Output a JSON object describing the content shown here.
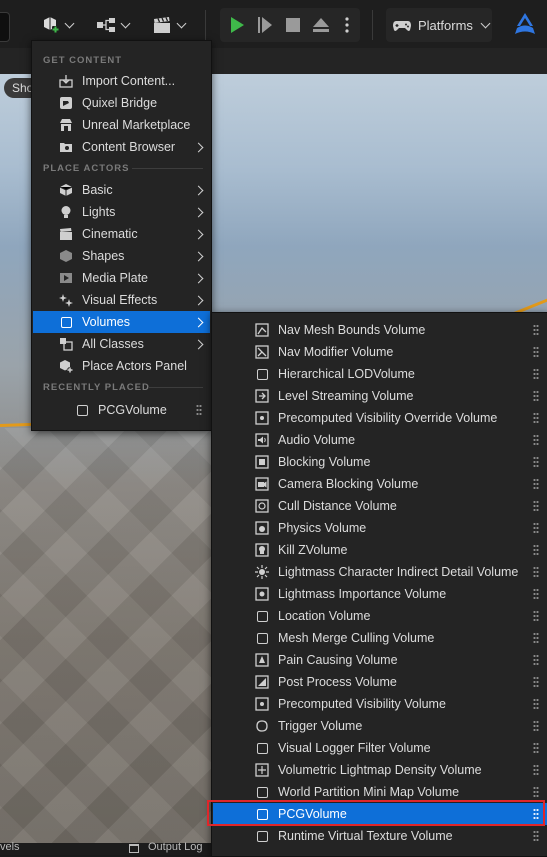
{
  "toolbar": {
    "platforms_label": "Platforms"
  },
  "viewport": {
    "show_label": "Sho"
  },
  "statusbar": {
    "left_text": "vels",
    "output_text": "Output Log"
  },
  "colors": {
    "accent": "#0e6fd8",
    "highlight": "#e0262a",
    "play_green": "#3fb94a"
  },
  "add_menu": {
    "get_content_header": "GET CONTENT",
    "get_content": [
      {
        "label": "Import Content...",
        "icon": "import-icon",
        "submenu": false
      },
      {
        "label": "Quixel Bridge",
        "icon": "bridge-icon",
        "submenu": false
      },
      {
        "label": "Unreal Marketplace",
        "icon": "marketplace-icon",
        "submenu": false
      },
      {
        "label": "Content Browser",
        "icon": "content-browser-icon",
        "submenu": true
      }
    ],
    "place_actors_header": "PLACE ACTORS",
    "place_actors": [
      {
        "label": "Basic",
        "icon": "cube-icon",
        "submenu": true
      },
      {
        "label": "Lights",
        "icon": "light-bulb-icon",
        "submenu": true
      },
      {
        "label": "Cinematic",
        "icon": "clapper-icon",
        "submenu": true
      },
      {
        "label": "Shapes",
        "icon": "shapes-icon",
        "submenu": true
      },
      {
        "label": "Media Plate",
        "icon": "media-plate-icon",
        "submenu": true
      },
      {
        "label": "Visual Effects",
        "icon": "sparkle-icon",
        "submenu": true
      },
      {
        "label": "Volumes",
        "icon": "volume-icon",
        "submenu": true,
        "active": true
      },
      {
        "label": "All Classes",
        "icon": "classes-icon",
        "submenu": true
      },
      {
        "label": "Place Actors Panel",
        "icon": "place-actors-icon",
        "submenu": false
      }
    ],
    "recently_placed_header": "RECENTLY PLACED",
    "recently_placed": [
      {
        "label": "PCGVolume",
        "icon": "volume-icon"
      }
    ]
  },
  "volumes_menu": {
    "items": [
      {
        "label": "Nav Mesh Bounds Volume",
        "icon": "nav-mesh-icon"
      },
      {
        "label": "Nav Modifier Volume",
        "icon": "nav-modifier-icon"
      },
      {
        "label": "Hierarchical LODVolume",
        "icon": "volume-icon"
      },
      {
        "label": "Level Streaming Volume",
        "icon": "streaming-icon"
      },
      {
        "label": "Precomputed Visibility Override Volume",
        "icon": "visibility-icon"
      },
      {
        "label": "Audio Volume",
        "icon": "audio-icon"
      },
      {
        "label": "Blocking Volume",
        "icon": "blocking-icon"
      },
      {
        "label": "Camera Blocking Volume",
        "icon": "camera-blocking-icon"
      },
      {
        "label": "Cull Distance Volume",
        "icon": "cull-distance-icon"
      },
      {
        "label": "Physics Volume",
        "icon": "physics-icon"
      },
      {
        "label": "Kill ZVolume",
        "icon": "kill-z-icon"
      },
      {
        "label": "Lightmass Character Indirect Detail Volume",
        "icon": "lightmass-icon"
      },
      {
        "label": "Lightmass Importance Volume",
        "icon": "lightmass-importance-icon"
      },
      {
        "label": "Location Volume",
        "icon": "volume-icon"
      },
      {
        "label": "Mesh Merge Culling Volume",
        "icon": "volume-icon"
      },
      {
        "label": "Pain Causing Volume",
        "icon": "pain-icon"
      },
      {
        "label": "Post Process Volume",
        "icon": "post-process-icon"
      },
      {
        "label": "Precomputed Visibility Volume",
        "icon": "visibility-icon"
      },
      {
        "label": "Trigger Volume",
        "icon": "trigger-icon"
      },
      {
        "label": "Visual Logger Filter Volume",
        "icon": "volume-icon"
      },
      {
        "label": "Volumetric Lightmap Density Volume",
        "icon": "volumetric-icon"
      },
      {
        "label": "World Partition Mini Map Volume",
        "icon": "volume-icon"
      },
      {
        "label": "PCGVolume",
        "icon": "volume-icon",
        "active": true
      },
      {
        "label": "Runtime Virtual Texture Volume",
        "icon": "volume-icon"
      }
    ]
  }
}
